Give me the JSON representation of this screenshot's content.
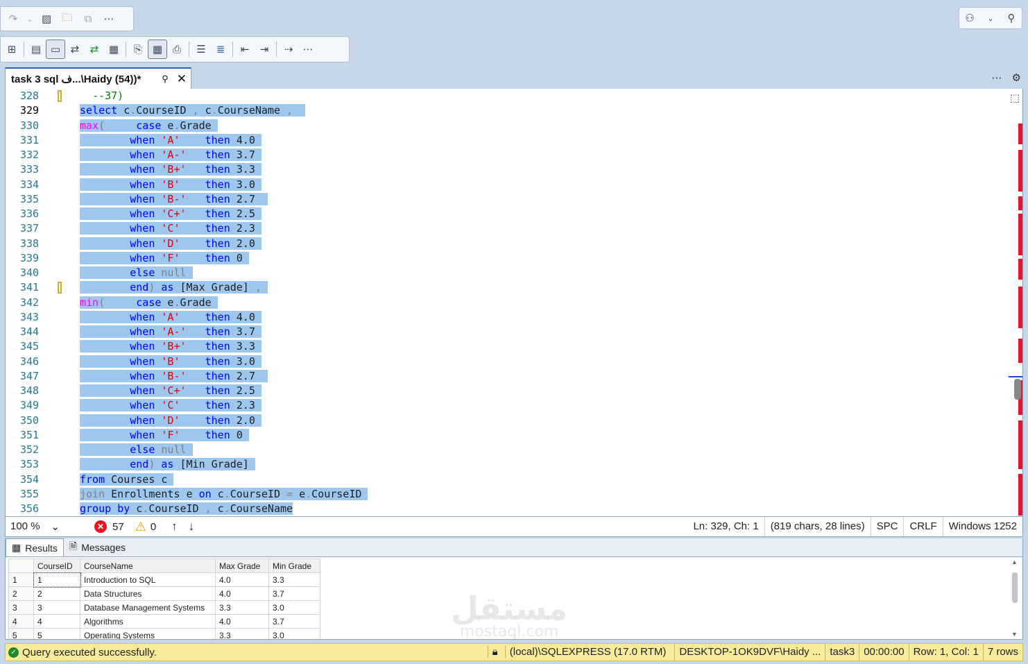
{
  "toolbar": {
    "top_icons": [
      "redo-icon",
      "dropdown-icon",
      "activity-monitor-icon",
      "object-explorer-search-icon",
      "template-icon",
      "more-icon"
    ],
    "query_icons": [
      "display-plan-icon",
      "results-to-text-icon",
      "results-to-grid-icon",
      "include-plan-icon",
      "live-stats-icon",
      "client-stats-icon",
      "sqlcmd-icon",
      "results-to-file-icon",
      "grid-icon",
      "copy-icon",
      "indent-icon",
      "comment-icon",
      "outdent-icon",
      "uncomment-icon",
      "parameters-icon",
      "more-icon"
    ],
    "more": "⋯"
  },
  "tab": {
    "title": "task 3 sql ف...\\Haidy (54))*",
    "pin": "⚲",
    "close": "✕"
  },
  "tab_right": {
    "more": "⋯",
    "settings": "⚙"
  },
  "editor": {
    "lines": [
      {
        "n": "328",
        "html": "  <span class='c'>--37)</span>",
        "sel": false,
        "chg": true
      },
      {
        "n": "329",
        "html": "<span class='hl'><span class='k'>select</span> c<span class='p'>.</span>CourseID <span class='p'>,</span> c<span class='p'>.</span>CourseName <span class='p'>,</span>  </span>",
        "sel": true,
        "cur": true
      },
      {
        "n": "330",
        "html": "<span class='hl'><span class='f'>max</span><span class='p'>(</span>     <span class='k'>case</span> e<span class='p'>.</span>Grade </span>"
      },
      {
        "n": "331",
        "html": "<span class='hl'>        <span class='k'>when</span> <span class='s'>'A'</span>    <span class='k'>then</span> 4.0 </span>"
      },
      {
        "n": "332",
        "html": "<span class='hl'>        <span class='k'>when</span> <span class='s'>'A-'</span>   <span class='k'>then</span> 3.7 </span>"
      },
      {
        "n": "333",
        "html": "<span class='hl'>        <span class='k'>when</span> <span class='s'>'B+'</span>   <span class='k'>then</span> 3.3 </span>"
      },
      {
        "n": "334",
        "html": "<span class='hl'>        <span class='k'>when</span> <span class='s'>'B'</span>    <span class='k'>then</span> 3.0 </span>"
      },
      {
        "n": "335",
        "html": "<span class='hl'>        <span class='k'>when</span> <span class='s'>'B-'</span>   <span class='k'>then</span> 2.7  </span>"
      },
      {
        "n": "336",
        "html": "<span class='hl'>        <span class='k'>when</span> <span class='s'>'C+'</span>   <span class='k'>then</span> 2.5 </span>"
      },
      {
        "n": "337",
        "html": "<span class='hl'>        <span class='k'>when</span> <span class='s'>'C'</span>    <span class='k'>then</span> 2.3 </span>"
      },
      {
        "n": "338",
        "html": "<span class='hl'>        <span class='k'>when</span> <span class='s'>'D'</span>    <span class='k'>then</span> 2.0 </span>"
      },
      {
        "n": "339",
        "html": "<span class='hl'>        <span class='k'>when</span> <span class='s'>'F'</span>    <span class='k'>then</span> 0 </span>"
      },
      {
        "n": "340",
        "html": "<span class='hl'>        <span class='k'>else</span> <span class='g'>null</span> </span>"
      },
      {
        "n": "341",
        "html": "<span class='hl'>        <span class='k'>end</span><span class='p'>)</span> <span class='k'>as</span> [Max Grade] <span class='p'>,</span> </span>",
        "chg": true
      },
      {
        "n": "342",
        "html": "<span class='hl'><span class='f'>min</span><span class='p'>(</span>     <span class='k'>case</span> e<span class='p'>.</span>Grade </span>"
      },
      {
        "n": "343",
        "html": "<span class='hl'>        <span class='k'>when</span> <span class='s'>'A'</span>    <span class='k'>then</span> 4.0 </span>"
      },
      {
        "n": "344",
        "html": "<span class='hl'>        <span class='k'>when</span> <span class='s'>'A-'</span>   <span class='k'>then</span> 3.7 </span>"
      },
      {
        "n": "345",
        "html": "<span class='hl'>        <span class='k'>when</span> <span class='s'>'B+'</span>   <span class='k'>then</span> 3.3 </span>"
      },
      {
        "n": "346",
        "html": "<span class='hl'>        <span class='k'>when</span> <span class='s'>'B'</span>    <span class='k'>then</span> 3.0 </span>"
      },
      {
        "n": "347",
        "html": "<span class='hl'>        <span class='k'>when</span> <span class='s'>'B-'</span>   <span class='k'>then</span> 2.7  </span>"
      },
      {
        "n": "348",
        "html": "<span class='hl'>        <span class='k'>when</span> <span class='s'>'C+'</span>   <span class='k'>then</span> 2.5 </span>"
      },
      {
        "n": "349",
        "html": "<span class='hl'>        <span class='k'>when</span> <span class='s'>'C'</span>    <span class='k'>then</span> 2.3 </span>"
      },
      {
        "n": "350",
        "html": "<span class='hl'>        <span class='k'>when</span> <span class='s'>'D'</span>    <span class='k'>then</span> 2.0 </span>"
      },
      {
        "n": "351",
        "html": "<span class='hl'>        <span class='k'>when</span> <span class='s'>'F'</span>    <span class='k'>then</span> 0 </span>"
      },
      {
        "n": "352",
        "html": "<span class='hl'>        <span class='k'>else</span> <span class='g'>null</span> </span>"
      },
      {
        "n": "353",
        "html": "<span class='hl'>        <span class='k'>end</span><span class='p'>)</span> <span class='k'>as</span> [Min Grade] </span>"
      },
      {
        "n": "354",
        "html": "<span class='hl'><span class='k'>from</span> Courses c </span>"
      },
      {
        "n": "355",
        "html": "<span class='hl'><span class='g'>join</span> Enrollments e <span class='k'>on</span> c<span class='p'>.</span>CourseID <span class='p'>=</span> e<span class='p'>.</span>CourseID </span>"
      },
      {
        "n": "356",
        "html": "<span class='hl'><span class='k'>group</span> <span class='k'>by</span> c<span class='p'>.</span>CourseID <span class='p'>,</span> c<span class='p'>.</span>CourseName</span>"
      }
    ]
  },
  "status": {
    "zoom": "100 %",
    "errors": "57",
    "warnings": "0",
    "position": "Ln: 329, Ch: 1",
    "chars": "(819 chars, 28 lines)",
    "spc": "SPC",
    "crlf": "CRLF",
    "encoding": "Windows 1252"
  },
  "results_tabs": {
    "results": "Results",
    "messages": "Messages"
  },
  "grid": {
    "columns": [
      "CourseID",
      "CourseName",
      "Max Grade",
      "Min Grade"
    ],
    "rows": [
      [
        "1",
        "1",
        "Introduction to SQL",
        "4.0",
        "3.3"
      ],
      [
        "2",
        "2",
        "Data Structures",
        "4.0",
        "3.7"
      ],
      [
        "3",
        "3",
        "Database Management Systems",
        "3.3",
        "3.0"
      ],
      [
        "4",
        "4",
        "Algorithms",
        "4.0",
        "3.7"
      ],
      [
        "5",
        "5",
        "Operating Systems",
        "3.3",
        "3.0"
      ]
    ]
  },
  "query_status": {
    "message": "Query executed successfully.",
    "server": "(local)\\SQLEXPRESS (17.0 RTM)",
    "user": "DESKTOP-1OK9DVF\\Haidy ...",
    "database": "task3",
    "time": "00:00:00",
    "rowcol": "Row: 1, Col: 1",
    "rows": "7 rows"
  },
  "watermark": {
    "ar": "مستقل",
    "en": "mostaql.com"
  },
  "colors": {
    "keyword": "#0000ff",
    "string": "#e00000",
    "function": "#ff00ff",
    "comment": "#008000",
    "selection": "#9ec7ef",
    "status_bar": "#f6eb99"
  }
}
